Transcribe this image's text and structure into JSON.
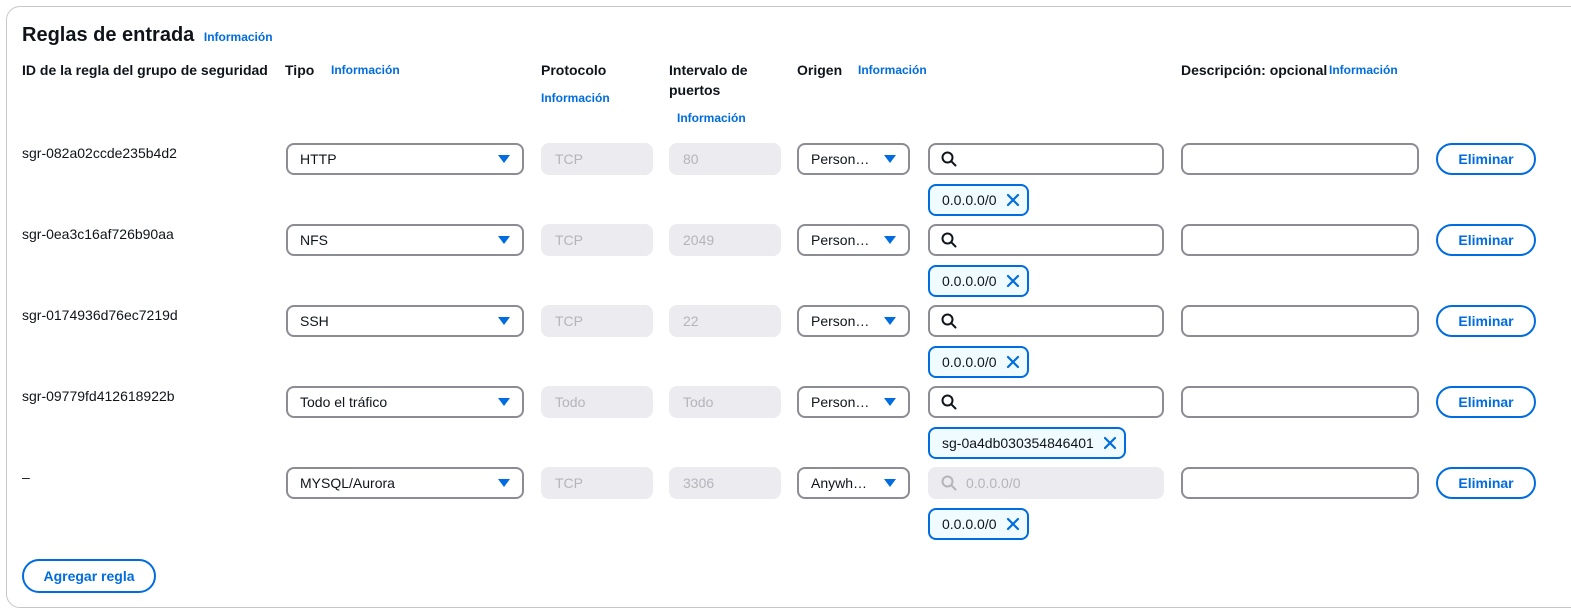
{
  "section": {
    "title": "Reglas de entrada",
    "info": "Información"
  },
  "headers": {
    "rule_id": "ID de la regla del grupo de seguridad",
    "type": "Tipo",
    "type_info": "Información",
    "protocol": "Protocolo",
    "protocol_info": "Información",
    "port_range_line1": "Intervalo de",
    "port_range_line2": "puertos",
    "port_range_info": "Información",
    "source": "Origen",
    "source_info": "Información",
    "description": "Descripción: opcional",
    "description_info": "Información"
  },
  "rules": [
    {
      "id": "sgr-082a02ccde235b4d2",
      "type": "HTTP",
      "protocol": "TCP",
      "port": "80",
      "source_type": "Person…",
      "source_query": "",
      "source_placeholder": "",
      "source_disabled": false,
      "token": "0.0.0.0/0",
      "description": "",
      "delete_label": "Eliminar"
    },
    {
      "id": "sgr-0ea3c16af726b90aa",
      "type": "NFS",
      "protocol": "TCP",
      "port": "2049",
      "source_type": "Person…",
      "source_query": "",
      "source_placeholder": "",
      "source_disabled": false,
      "token": "0.0.0.0/0",
      "description": "",
      "delete_label": "Eliminar"
    },
    {
      "id": "sgr-0174936d76ec7219d",
      "type": "SSH",
      "protocol": "TCP",
      "port": "22",
      "source_type": "Person…",
      "source_query": "",
      "source_placeholder": "",
      "source_disabled": false,
      "token": "0.0.0.0/0",
      "description": "",
      "delete_label": "Eliminar"
    },
    {
      "id": "sgr-09779fd412618922b",
      "type": "Todo el tráfico",
      "protocol": "Todo",
      "port": "Todo",
      "source_type": "Person…",
      "source_query": "",
      "source_placeholder": "",
      "source_disabled": false,
      "token": "sg-0a4db030354846401",
      "description": "",
      "delete_label": "Eliminar"
    },
    {
      "id": "–",
      "type": "MYSQL/Aurora",
      "protocol": "TCP",
      "port": "3306",
      "source_type": "Anywh…",
      "source_query": "",
      "source_placeholder": "0.0.0.0/0",
      "source_disabled": true,
      "token": "0.0.0.0/0",
      "description": "",
      "delete_label": "Eliminar"
    }
  ],
  "add_rule_label": "Agregar regla",
  "icons": {
    "search": "search-icon",
    "remove_token": "close-icon",
    "dropdown": "caret-down-icon"
  },
  "colors": {
    "accent": "#006ce0",
    "border": "#8c8c94",
    "disabled_bg": "#ebebf0"
  }
}
